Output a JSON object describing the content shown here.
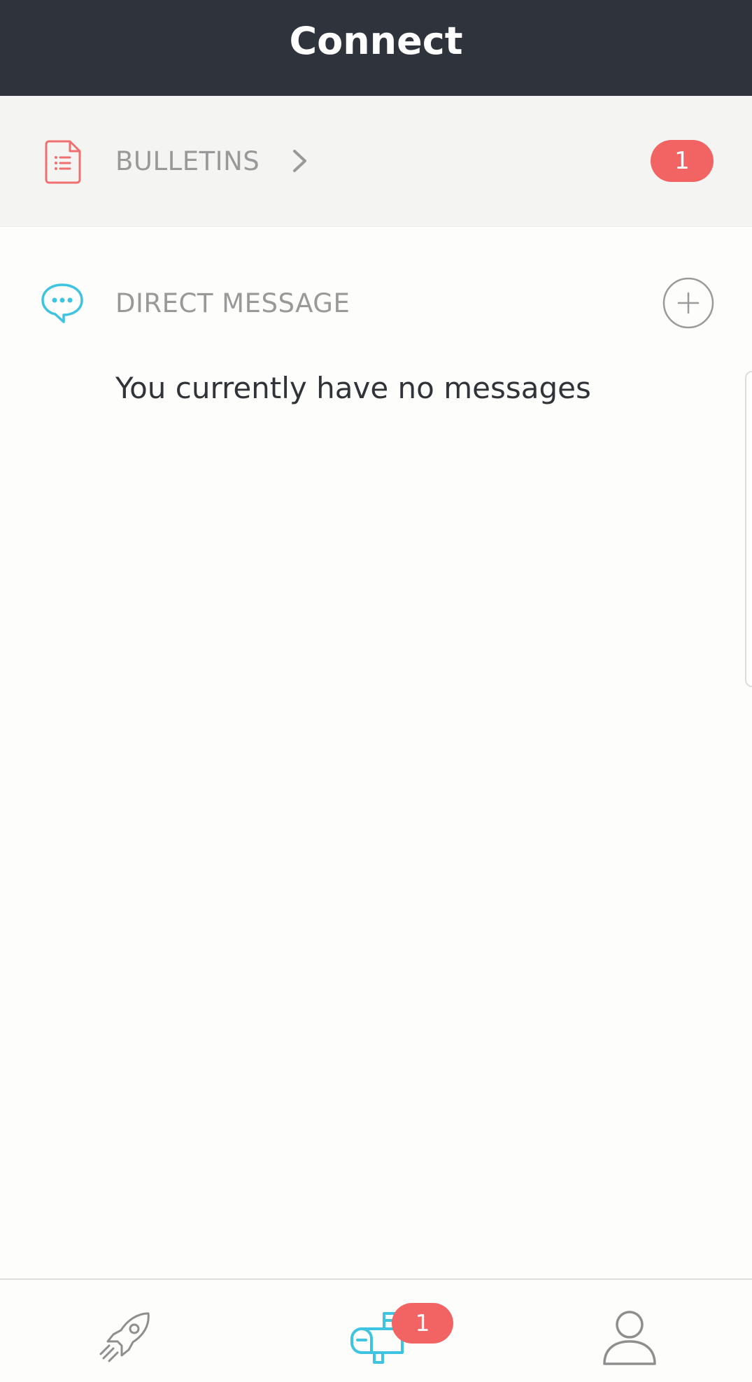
{
  "header": {
    "title": "Connect"
  },
  "bulletins": {
    "label": "BULLETINS",
    "badge_count": "1",
    "icon": "document-list-icon"
  },
  "direct_message": {
    "label": "DIRECT MESSAGE",
    "icon": "chat-bubble-icon",
    "add_icon": "plus-circle-icon",
    "empty_text": "You currently have no messages"
  },
  "bottom_nav": {
    "items": [
      {
        "icon": "rocket-icon",
        "active": false
      },
      {
        "icon": "mailbox-icon",
        "active": true,
        "badge_count": "1"
      },
      {
        "icon": "profile-icon",
        "active": false
      }
    ]
  },
  "colors": {
    "header_bg": "#2f333b",
    "badge_red": "#f26464",
    "accent_red_icon": "#f07070",
    "accent_blue": "#3ec3e0",
    "label_gray": "#999999",
    "icon_gray": "#8e8e8e"
  }
}
